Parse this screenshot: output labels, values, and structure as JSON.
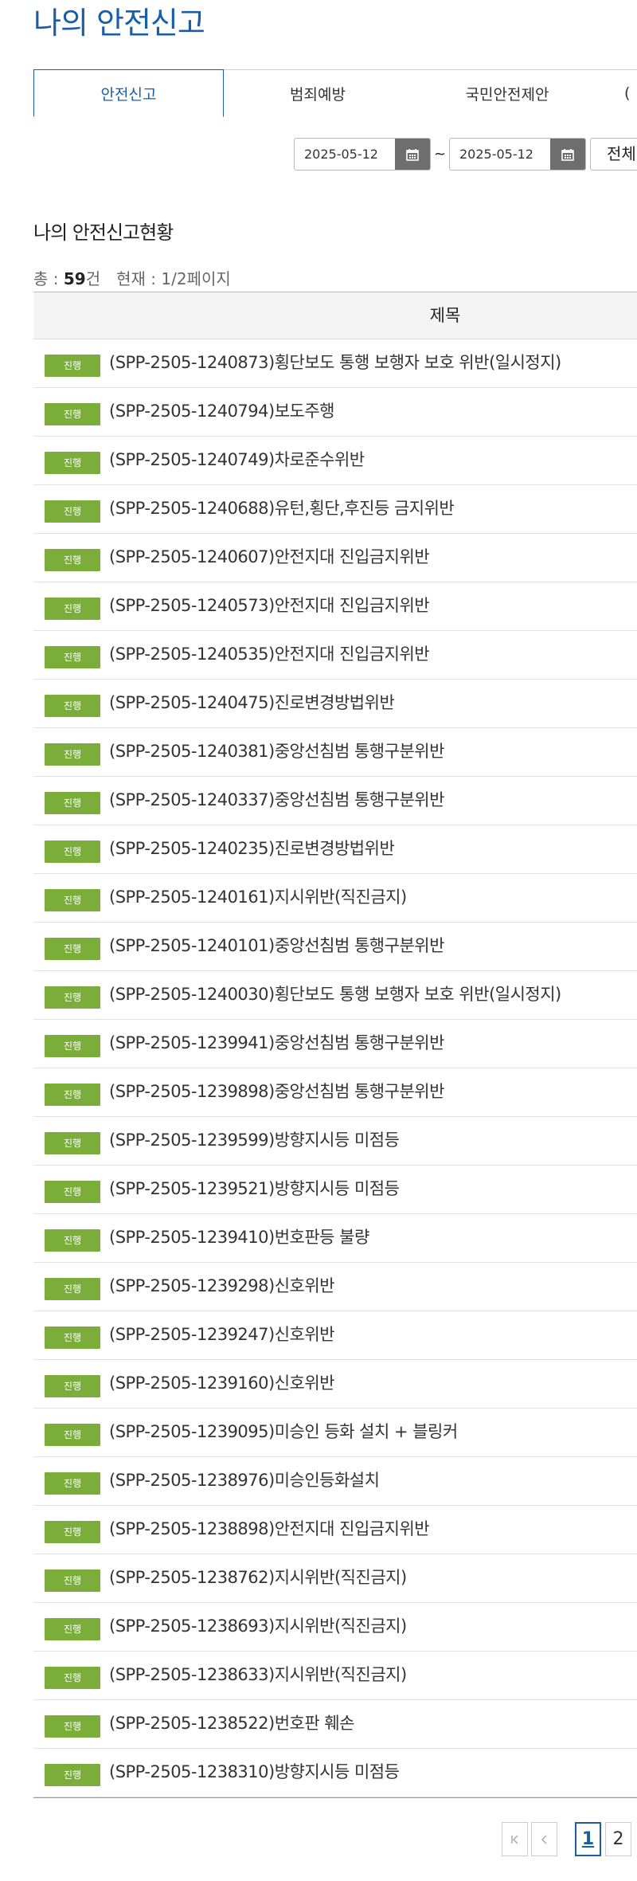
{
  "page_title": "나의 안전신고",
  "tabs": [
    {
      "label": "안전신고",
      "active": true
    },
    {
      "label": "범죄예방",
      "active": false
    },
    {
      "label": "국민안전제안",
      "active": false
    },
    {
      "label": "(",
      "active": false
    }
  ],
  "search": {
    "start_date": "2025-05-12",
    "end_date": "2025-05-12",
    "tilde": "~",
    "range_label": "전체"
  },
  "section_title": "나의 안전신고현황",
  "summary": {
    "total_prefix": "총 : ",
    "total_count": "59",
    "total_suffix": "건",
    "current_label": "현재 : 1/2페이지"
  },
  "table": {
    "header": "제목",
    "rows": [
      {
        "status": "진행",
        "title": "(SPP-2505-1240873)횡단보도 통행 보행자 보호 위반(일시정지)"
      },
      {
        "status": "진행",
        "title": "(SPP-2505-1240794)보도주행"
      },
      {
        "status": "진행",
        "title": "(SPP-2505-1240749)차로준수위반"
      },
      {
        "status": "진행",
        "title": "(SPP-2505-1240688)유턴,횡단,후진등 금지위반"
      },
      {
        "status": "진행",
        "title": "(SPP-2505-1240607)안전지대 진입금지위반"
      },
      {
        "status": "진행",
        "title": "(SPP-2505-1240573)안전지대 진입금지위반"
      },
      {
        "status": "진행",
        "title": "(SPP-2505-1240535)안전지대 진입금지위반"
      },
      {
        "status": "진행",
        "title": "(SPP-2505-1240475)진로변경방법위반"
      },
      {
        "status": "진행",
        "title": "(SPP-2505-1240381)중앙선침범 통행구분위반"
      },
      {
        "status": "진행",
        "title": "(SPP-2505-1240337)중앙선침범 통행구분위반"
      },
      {
        "status": "진행",
        "title": "(SPP-2505-1240235)진로변경방법위반"
      },
      {
        "status": "진행",
        "title": "(SPP-2505-1240161)지시위반(직진금지)"
      },
      {
        "status": "진행",
        "title": "(SPP-2505-1240101)중앙선침범 통행구분위반"
      },
      {
        "status": "진행",
        "title": "(SPP-2505-1240030)횡단보도 통행 보행자 보호 위반(일시정지)"
      },
      {
        "status": "진행",
        "title": "(SPP-2505-1239941)중앙선침범 통행구분위반"
      },
      {
        "status": "진행",
        "title": "(SPP-2505-1239898)중앙선침범 통행구분위반"
      },
      {
        "status": "진행",
        "title": "(SPP-2505-1239599)방향지시등 미점등"
      },
      {
        "status": "진행",
        "title": "(SPP-2505-1239521)방향지시등 미점등"
      },
      {
        "status": "진행",
        "title": "(SPP-2505-1239410)번호판등 불량"
      },
      {
        "status": "진행",
        "title": "(SPP-2505-1239298)신호위반"
      },
      {
        "status": "진행",
        "title": "(SPP-2505-1239247)신호위반"
      },
      {
        "status": "진행",
        "title": "(SPP-2505-1239160)신호위반"
      },
      {
        "status": "진행",
        "title": "(SPP-2505-1239095)미승인 등화 설치 + 블링커"
      },
      {
        "status": "진행",
        "title": "(SPP-2505-1238976)미승인등화설치"
      },
      {
        "status": "진행",
        "title": "(SPP-2505-1238898)안전지대 진입금지위반"
      },
      {
        "status": "진행",
        "title": "(SPP-2505-1238762)지시위반(직진금지)"
      },
      {
        "status": "진행",
        "title": "(SPP-2505-1238693)지시위반(직진금지)"
      },
      {
        "status": "진행",
        "title": "(SPP-2505-1238633)지시위반(직진금지)"
      },
      {
        "status": "진행",
        "title": "(SPP-2505-1238522)번호판 훼손"
      },
      {
        "status": "진행",
        "title": "(SPP-2505-1238310)방향지시등 미점등"
      }
    ]
  },
  "pagination": {
    "first_icon": "first-page-icon",
    "prev_icon": "prev-page-icon",
    "pages": [
      "1",
      "2"
    ],
    "current_page": "1"
  },
  "colors": {
    "brand_blue": "#1a5ea8",
    "status_green": "#7aad3a",
    "calendar_button": "#6e6e6e"
  }
}
